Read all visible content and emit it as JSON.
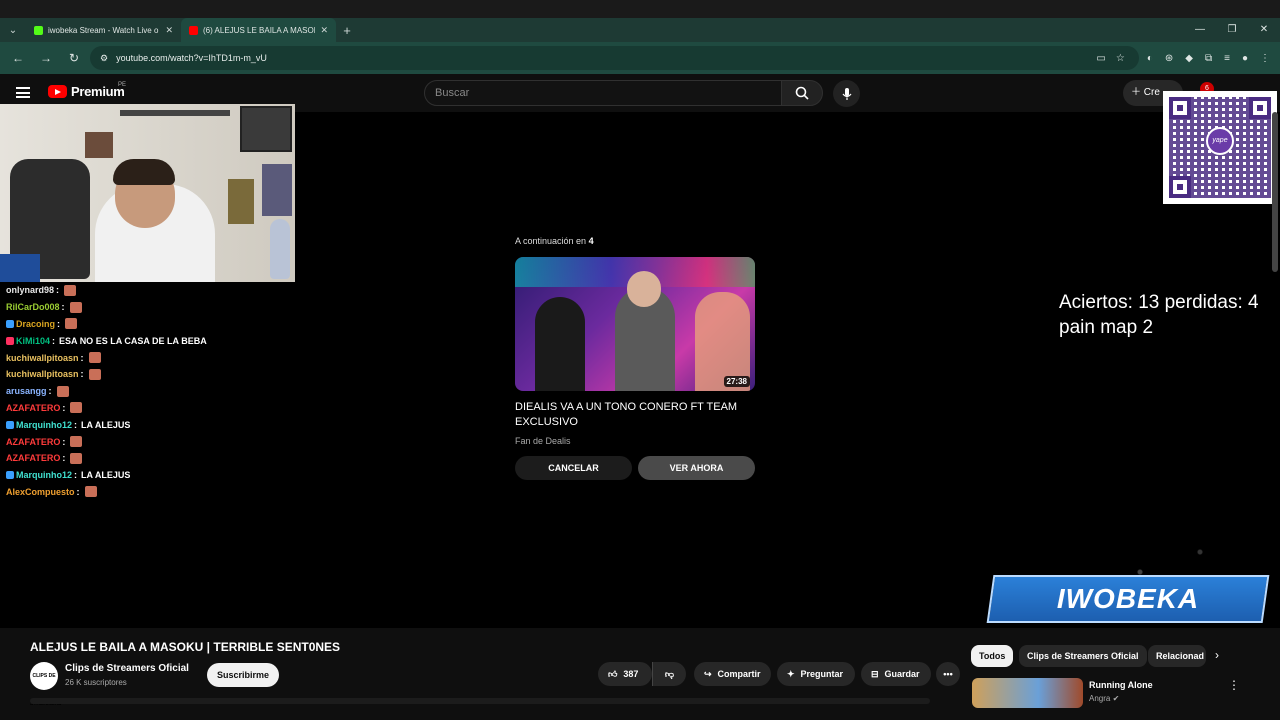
{
  "browser": {
    "tabs": [
      {
        "title": "iwobeka Stream - Watch Live o",
        "favicon_color": "#53fc18",
        "active": false
      },
      {
        "title": "(6) ALEJUS LE BAILA A MASOKI",
        "favicon_color": "#ff0000",
        "active": true
      }
    ],
    "url": "youtube.com/watch?v=IhTD1m-m_vU"
  },
  "youtube": {
    "logo_text": "Premium",
    "logo_country": "PE",
    "search_placeholder": "Buscar",
    "create_label": "Cre",
    "notification_count": "6"
  },
  "chat": [
    {
      "user": "onlynard98",
      "color": "#e8e8e8",
      "msg": "",
      "emote": true,
      "badge": ""
    },
    {
      "user": "RilCarDo008",
      "color": "#9acd32",
      "msg": "",
      "emote": true,
      "badge": ""
    },
    {
      "user": "Dracoing",
      "color": "#daa520",
      "msg": "",
      "emote": true,
      "badge": "#3aa0ff"
    },
    {
      "user": "KiMi104",
      "color": "#00c080",
      "msg": "ESA NO ES LA CASA DE LA BEBA",
      "emote": false,
      "badge": "#ff3060"
    },
    {
      "user": "kuchiwallpitoasn",
      "color": "#e8c060",
      "msg": "",
      "emote": true,
      "badge": ""
    },
    {
      "user": "kuchiwallpitoasn",
      "color": "#e8c060",
      "msg": "",
      "emote": true,
      "badge": ""
    },
    {
      "user": "arusangg",
      "color": "#8ab4ff",
      "msg": "",
      "emote": true,
      "badge": ""
    },
    {
      "user": "AZAFATERO",
      "color": "#ff3b3b",
      "msg": "",
      "emote": true,
      "badge": ""
    },
    {
      "user": "Marquinho12",
      "color": "#40e0d0",
      "msg": "LA ALEJUS",
      "emote": false,
      "badge": "#3aa0ff"
    },
    {
      "user": "AZAFATERO",
      "color": "#ff3b3b",
      "msg": "",
      "emote": true,
      "badge": ""
    },
    {
      "user": "AZAFATERO",
      "color": "#ff3b3b",
      "msg": "",
      "emote": true,
      "badge": ""
    },
    {
      "user": "Marquinho12",
      "color": "#40e0d0",
      "msg": "LA ALEJUS",
      "emote": false,
      "badge": "#3aa0ff"
    },
    {
      "user": "AlexCompuesto",
      "color": "#f0a030",
      "msg": "",
      "emote": true,
      "badge": ""
    }
  ],
  "upnext": {
    "label": "A continuación en",
    "countdown": "4",
    "duration": "27:38",
    "title": "DIEALIS VA A UN TONO CONERO FT TEAM EXCLUSIVO",
    "channel": "Fan de Dealis",
    "cancel": "CANCELAR",
    "watch": "VER AHORA"
  },
  "overlay": {
    "score_line1": "Aciertos: 13 perdidas: 4",
    "score_line2": "pain map 2",
    "banner": "IWOBEKA",
    "qr_text": "yape"
  },
  "video": {
    "title": "ALEJUS LE BAILA A MASOKU | TERRIBLE SENT0NES",
    "channel": "Clips de Streamers Oficial",
    "channel_avatar_text": "CLIPS DE STREAMERS",
    "subs": "26 K suscriptores",
    "subscribe": "Suscribirme",
    "likes": "387",
    "share": "Compartir",
    "ask": "Preguntar",
    "save": "Guardar"
  },
  "related": {
    "chips": [
      "Todos",
      "Clips de Streamers Oficial",
      "Relacionad"
    ],
    "item_title": "Running Alone",
    "item_channel": "Angra"
  }
}
